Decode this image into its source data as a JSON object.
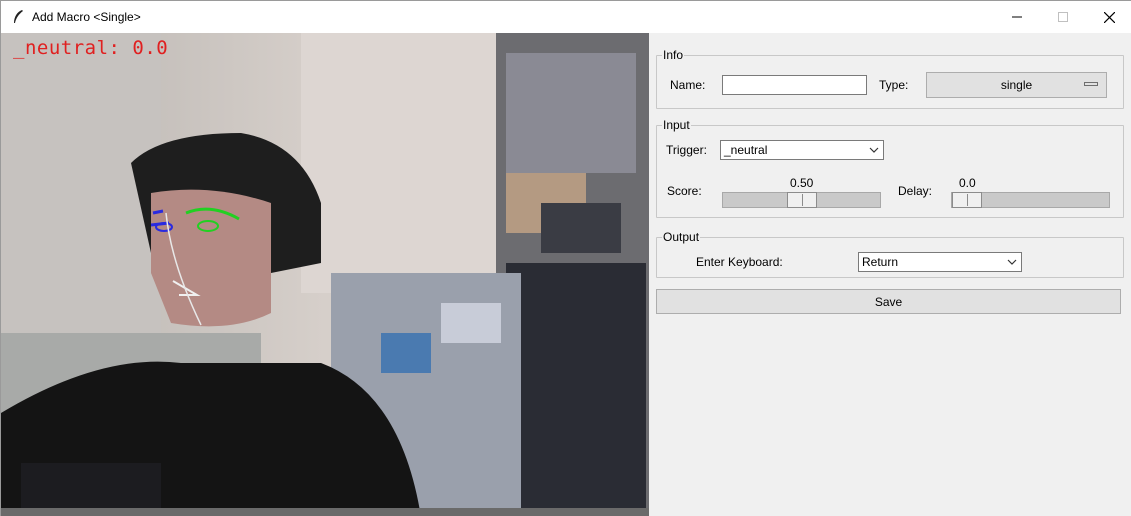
{
  "window": {
    "title": "Add Macro <Single>"
  },
  "titlebar_controls": [
    "minimize-icon",
    "maximize-icon",
    "close-icon"
  ],
  "camera": {
    "overlay_text": "_neutral: 0.0",
    "overlay_color": "#e02020",
    "landmark_eye_color": "#2020e0",
    "landmark_brow_color": "#20d020"
  },
  "info": {
    "legend": "Info",
    "name_label": "Name:",
    "name_value": "",
    "type_label": "Type:",
    "type_value": "single"
  },
  "input": {
    "legend": "Input",
    "trigger_label": "Trigger:",
    "trigger_value": "_neutral",
    "score_label": "Score:",
    "score_value": "0.50",
    "score_fraction": 0.5,
    "delay_label": "Delay:",
    "delay_value": "0.0",
    "delay_fraction": 0.0
  },
  "output": {
    "legend": "Output",
    "keyboard_label": "Enter Keyboard:",
    "keyboard_value": "Return"
  },
  "save_label": "Save"
}
